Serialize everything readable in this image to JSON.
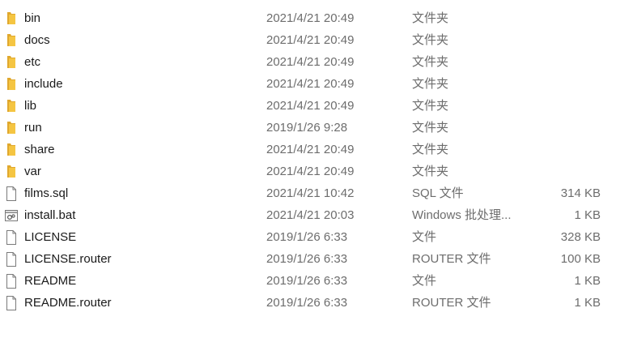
{
  "colors": {
    "folder": "#F5C542",
    "folder_dark": "#E0A82E",
    "file_outline": "#7a7a7a",
    "meta_text": "#6d6d6d"
  },
  "files": [
    {
      "name": "bin",
      "date": "2021/4/21 20:49",
      "type": "文件夹",
      "size": "",
      "icon": "folder-icon"
    },
    {
      "name": "docs",
      "date": "2021/4/21 20:49",
      "type": "文件夹",
      "size": "",
      "icon": "folder-icon"
    },
    {
      "name": "etc",
      "date": "2021/4/21 20:49",
      "type": "文件夹",
      "size": "",
      "icon": "folder-icon"
    },
    {
      "name": "include",
      "date": "2021/4/21 20:49",
      "type": "文件夹",
      "size": "",
      "icon": "folder-icon"
    },
    {
      "name": "lib",
      "date": "2021/4/21 20:49",
      "type": "文件夹",
      "size": "",
      "icon": "folder-icon"
    },
    {
      "name": "run",
      "date": "2019/1/26 9:28",
      "type": "文件夹",
      "size": "",
      "icon": "folder-icon"
    },
    {
      "name": "share",
      "date": "2021/4/21 20:49",
      "type": "文件夹",
      "size": "",
      "icon": "folder-icon"
    },
    {
      "name": "var",
      "date": "2021/4/21 20:49",
      "type": "文件夹",
      "size": "",
      "icon": "folder-icon"
    },
    {
      "name": "films.sql",
      "date": "2021/4/21 10:42",
      "type": "SQL 文件",
      "size": "314 KB",
      "icon": "file-icon"
    },
    {
      "name": "install.bat",
      "date": "2021/4/21 20:03",
      "type": "Windows 批处理...",
      "size": "1 KB",
      "icon": "batch-file-icon"
    },
    {
      "name": "LICENSE",
      "date": "2019/1/26 6:33",
      "type": "文件",
      "size": "328 KB",
      "icon": "file-icon"
    },
    {
      "name": "LICENSE.router",
      "date": "2019/1/26 6:33",
      "type": "ROUTER 文件",
      "size": "100 KB",
      "icon": "file-icon"
    },
    {
      "name": "README",
      "date": "2019/1/26 6:33",
      "type": "文件",
      "size": "1 KB",
      "icon": "file-icon"
    },
    {
      "name": "README.router",
      "date": "2019/1/26 6:33",
      "type": "ROUTER 文件",
      "size": "1 KB",
      "icon": "file-icon"
    }
  ]
}
